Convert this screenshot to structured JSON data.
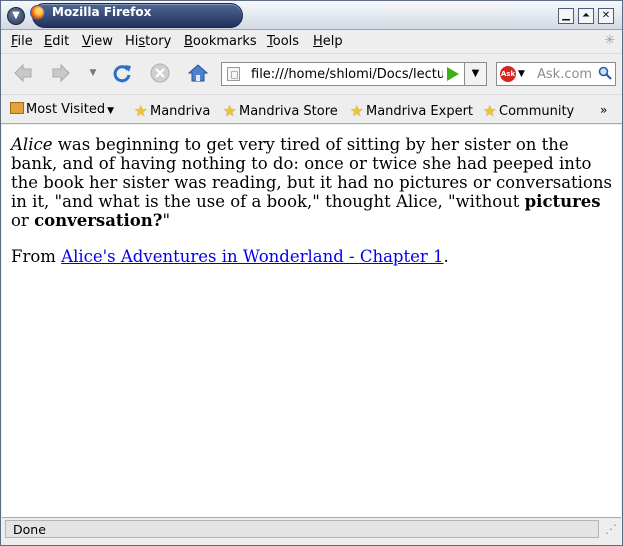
{
  "window": {
    "title": "Mozilla Firefox"
  },
  "menu": [
    {
      "prefix": "",
      "key": "F",
      "rest": "ile"
    },
    {
      "prefix": "",
      "key": "E",
      "rest": "dit"
    },
    {
      "prefix": "",
      "key": "V",
      "rest": "iew"
    },
    {
      "prefix": "Hi",
      "key": "s",
      "rest": "tory"
    },
    {
      "prefix": "",
      "key": "B",
      "rest": "ookmarks"
    },
    {
      "prefix": "",
      "key": "T",
      "rest": "ools"
    },
    {
      "prefix": "",
      "key": "H",
      "rest": "elp"
    }
  ],
  "nav": {
    "url": "file:///home/shlomi/Docs/lectur",
    "search_placeholder": "Ask.com",
    "search_engine_label": "Ask"
  },
  "bookmarks": {
    "most_visited": "Most Visited",
    "items": [
      "Mandriva",
      "Mandriva Store",
      "Mandriva Expert",
      "Community"
    ],
    "overflow": "»"
  },
  "content": {
    "p1": {
      "em": "Alice",
      "text1": " was beginning to get very tired of sitting by her sister on the bank, and of having nothing to do: once or twice she had peeped into the book her sister was reading, but it had no pictures or conversations in it, \"and what is the use of a book,\" thought Alice, \"without ",
      "strong1": "pictures",
      "text2": " or ",
      "strong2": "conversation?",
      "text3": "\""
    },
    "p2": {
      "prefix": "From ",
      "link": "Alice's Adventures in Wonderland - Chapter 1",
      "suffix": "."
    }
  },
  "status": {
    "text": "Done"
  },
  "colors": {
    "link": "#0000ee",
    "title_pill": "#2f4675",
    "go_arrow": "#3fae1b"
  }
}
